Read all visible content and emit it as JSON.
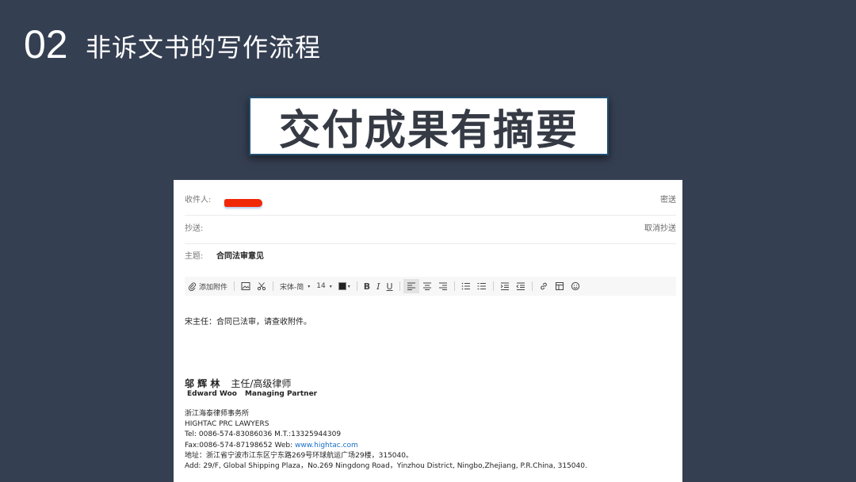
{
  "slide": {
    "number": "02",
    "title": "非诉文书的写作流程",
    "banner": "交付成果有摘要"
  },
  "mail": {
    "to_label": "收件人:",
    "bcc_link": "密送",
    "cc_label": "抄送:",
    "cancel_cc_link": "取消抄送",
    "subject_label": "主题:",
    "subject": "合同法审意见",
    "toolbar": {
      "attach": "添加附件",
      "font": "宋体-简",
      "size": "14"
    },
    "body": "宋主任：合同已法审，请查收附件。",
    "signature": {
      "name_cn": "邬 辉 林",
      "role_cn": "主任/高级律师",
      "name_en": "Edward Woo",
      "role_en": "Managing Partner",
      "firm_cn": "浙江海泰律师事务所",
      "firm_en": "HIGHTAC PRC LAWYERS",
      "tel": "Tel: 0086-574-83086036  M.T.:13325944309",
      "fax": "Fax:0086-574-87198652 Web: ",
      "web": "www.hightac.com",
      "addr_cn": "地址：浙江省宁波市江东区宁东路269号环球航运广场29楼，315040。",
      "addr_en": "Add: 29/F, Global Shipping Plaza，No.269 Ningdong Road，Yinzhou District, Ningbo,Zhejiang, P.R.China, 315040."
    }
  }
}
